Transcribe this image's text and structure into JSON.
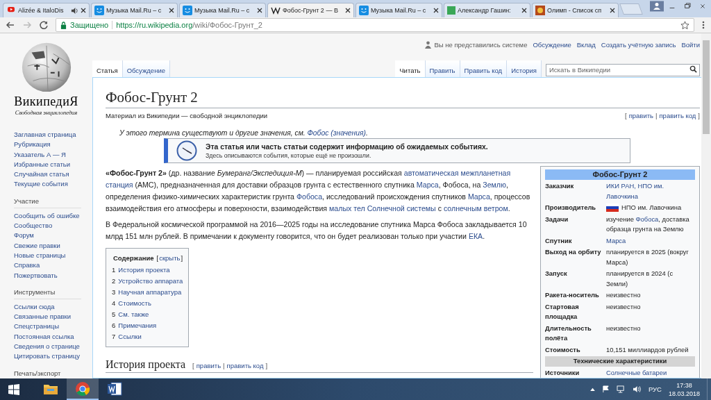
{
  "browser": {
    "tabs": [
      {
        "title": "Alizée & ItaloDis",
        "kind": "video",
        "audio": true,
        "selected": false
      },
      {
        "title": "Музыка Mail.Ru – с",
        "kind": "mail",
        "audio": false,
        "selected": false
      },
      {
        "title": "Музыка Mail.Ru – с",
        "kind": "mail",
        "audio": false,
        "selected": false
      },
      {
        "title": "Фобос-Грунт 2 — В",
        "kind": "wiki",
        "audio": false,
        "selected": true
      },
      {
        "title": "Музыка Mail.Ru – с",
        "kind": "mail",
        "audio": false,
        "selected": false
      },
      {
        "title": "Александр Гашин: ",
        "kind": "sheet",
        "audio": false,
        "selected": false
      },
      {
        "title": "Олимп - Список сп",
        "kind": "olimp",
        "audio": false,
        "selected": false
      }
    ],
    "secure_label": "Защищено",
    "url_host": "https://ru.wikipedia.org",
    "url_path": "/wiki/Фобос-Грунт_2"
  },
  "logo": {
    "wordmark": "ВикипедиЯ",
    "tagline": "Свободная энциклопедия"
  },
  "sidebar": {
    "sections": [
      {
        "items": [
          "Заглавная страница",
          "Рубрикация",
          "Указатель А — Я",
          "Избранные статьи",
          "Случайная статья",
          "Текущие события"
        ]
      },
      {
        "heading": "Участие",
        "items": [
          "Сообщить об ошибке",
          "Сообщество",
          "Форум",
          "Свежие правки",
          "Новые страницы",
          "Справка",
          "Пожертвовать"
        ]
      },
      {
        "heading": "Инструменты",
        "items": [
          "Ссылки сюда",
          "Связанные правки",
          "Спецстраницы",
          "Постоянная ссылка",
          "Сведения о странице",
          "Цитировать страницу"
        ]
      },
      {
        "heading": "Печать/экспорт"
      }
    ]
  },
  "personal": {
    "status": "Вы не представились системе",
    "links": [
      "Обсуждение",
      "Вклад",
      "Создать учётную запись",
      "Войти"
    ]
  },
  "namespace_tabs": [
    {
      "label": "Статья",
      "selected": true
    },
    {
      "label": "Обсуждение",
      "selected": false
    }
  ],
  "view_tabs": [
    {
      "label": "Читать",
      "selected": true
    },
    {
      "label": "Править",
      "selected": false
    },
    {
      "label": "Править код",
      "selected": false
    },
    {
      "label": "История",
      "selected": false
    }
  ],
  "search": {
    "placeholder": "Искать в Википедии"
  },
  "article": {
    "title": "Фобос-Грунт 2",
    "subtitle": "Материал из Википедии — свободной энциклопедии",
    "edit_links": {
      "open": "[",
      "links": [
        "править",
        "править код"
      ],
      "separator": "|",
      "close": "]"
    },
    "hatnote": [
      {
        "text": "У этого термина существуют и другие значения, см. "
      },
      {
        "text": "Фобос (значения)",
        "link": true
      },
      {
        "text": "."
      }
    ],
    "notice": {
      "title": "Эта статья или часть статьи содержит информацию об ожидаемых событиях.",
      "text": "Здесь описываются события, которые ещё не произошли."
    },
    "paragraphs": [
      [
        {
          "text": "«Фобос-Грунт 2»",
          "bold": true
        },
        {
          "text": " (др. название "
        },
        {
          "text": "Бумеранг/Экспедиция-М",
          "italic": true
        },
        {
          "text": ") — планируемая российская "
        },
        {
          "text": "автоматическая межпланетная",
          "link": true
        },
        {
          "text": "станция",
          "link": true
        },
        {
          "text": " (АМС), предназначенная для доставки образцов грунта с естественного спутника "
        },
        {
          "text": "Марса",
          "link": true
        },
        {
          "text": ", Фобоса, на "
        },
        {
          "text": "Землю",
          "link": true
        },
        {
          "text": ", определения физико-химических характеристик грунта "
        },
        {
          "text": "Фобоса",
          "link": true
        },
        {
          "text": ", исследований происхождения спутников "
        },
        {
          "text": "Марса",
          "link": true
        },
        {
          "text": ", процессов взаимодействия его атмосферы и поверхности, взаимодействия "
        },
        {
          "text": "малых тел Солнечной системы",
          "link": true
        },
        {
          "text": " с "
        },
        {
          "text": "солнечным ветром",
          "link": true
        },
        {
          "text": "."
        }
      ],
      [
        {
          "text": "В Федеральной космической программой на 2016—2025 годы на исследование спутника Марса Фобоса закладывается 10 млрд 151 млн рублей. В примечании к документу говорится, что он будет реализован только при участии "
        },
        {
          "text": "ЕКА",
          "link": true
        },
        {
          "text": "."
        }
      ]
    ],
    "toc": {
      "title": "Содержание",
      "open": "[",
      "toggle": "скрыть",
      "close": "]",
      "items": [
        {
          "number": "1",
          "text": "История проекта"
        },
        {
          "number": "2",
          "text": "Устройство аппарата"
        },
        {
          "number": "3",
          "text": "Научная аппаратура"
        },
        {
          "number": "4",
          "text": "Стоимость"
        },
        {
          "number": "5",
          "text": "См. также"
        },
        {
          "number": "6",
          "text": "Примечания"
        },
        {
          "number": "7",
          "text": "Ссылки"
        }
      ]
    },
    "section": {
      "title": "История проекта",
      "edit_links": {
        "open": "[",
        "links": [
          "править",
          "править код"
        ],
        "separator": "|",
        "close": "]"
      }
    }
  },
  "infobox": {
    "title": "Фобос-Грунт 2",
    "rows": [
      {
        "kind": "field",
        "label": "Заказчик",
        "value": [
          {
            "text": "ИКИ РАН, НПО им. Лавочкина",
            "link": true
          }
        ]
      },
      {
        "kind": "field",
        "label": "Производитель",
        "flag": true,
        "value": [
          {
            "text": "НПО им. Лавочкина"
          }
        ]
      },
      {
        "kind": "field",
        "label": "Задачи",
        "value": [
          {
            "text": "изучение "
          },
          {
            "text": "Фобоса",
            "link": true
          },
          {
            "text": ", доставка образца грунта на Землю"
          }
        ]
      },
      {
        "kind": "field",
        "label": "Спутник",
        "value": [
          {
            "text": "Марса",
            "link": true
          }
        ]
      },
      {
        "kind": "field",
        "label": "Выход на орбиту",
        "value": [
          {
            "text": "планируется в 2025 (вокруг Марса)"
          }
        ]
      },
      {
        "kind": "field",
        "label": "Запуск",
        "value": [
          {
            "text": "планируется в 2024 (с Земли)"
          }
        ]
      },
      {
        "kind": "field",
        "label": "Ракета-носитель",
        "value": [
          {
            "text": "неизвестно"
          }
        ]
      },
      {
        "kind": "field",
        "label": "Стартовая площадка",
        "value": [
          {
            "text": "неизвестно"
          }
        ]
      },
      {
        "kind": "field",
        "label": "Длительность полёта",
        "value": [
          {
            "text": "неизвестно"
          }
        ]
      },
      {
        "kind": "field",
        "label": "Стоимость",
        "value": [
          {
            "text": "10,151 миллиардов рублей"
          }
        ]
      },
      {
        "kind": "header",
        "label": "Технические характеристики"
      },
      {
        "kind": "field",
        "label": "Источники",
        "value": [
          {
            "text": "Солнечные батареи",
            "link": true
          }
        ]
      }
    ]
  },
  "taskbar": {
    "apps": [
      {
        "kind": "explorer",
        "selected": false
      },
      {
        "kind": "chrome",
        "selected": true
      },
      {
        "kind": "word",
        "selected": false
      }
    ],
    "language": "РУС",
    "time": "17:38",
    "date": "18.03.2018"
  }
}
